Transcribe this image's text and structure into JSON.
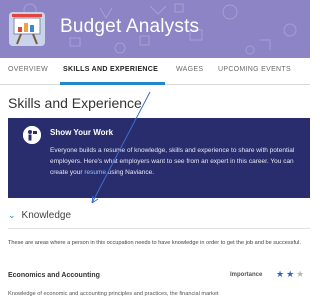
{
  "header": {
    "title": "Budget Analysts",
    "bg_color": "#8d84c6",
    "logo_icon": "chart-on-easel-icon"
  },
  "tabs": [
    {
      "label": "OVERVIEW",
      "active": false
    },
    {
      "label": "SKILLS AND EXPERIENCE",
      "active": true
    },
    {
      "label": "WAGES",
      "active": false
    },
    {
      "label": "UPCOMING EVENTS",
      "active": false
    }
  ],
  "accent_color": "#1f8ac7",
  "page": {
    "title": "Skills and Experience"
  },
  "callout": {
    "heading": "Show Your Work",
    "body_pre": "Everyone builds a resume of knowledge, skills and experience to share with potential employers. Here's what employers want to see from an expert in this career. You can create your ",
    "link_text": "resume",
    "body_post": " using Naviance.",
    "bg_color": "#2a2d6d",
    "icon": "person-presenting-icon"
  },
  "section": {
    "label": "Knowledge",
    "chevron_icon": "chevron-down-icon",
    "intro": "These are areas where a person in this occupation needs to have knowledge in order to get the job and be successful."
  },
  "skill": {
    "title": "Economics and Accounting",
    "importance_label": "Importance",
    "rating_filled": 2,
    "rating_shown": 3,
    "description": "Knowledge of economic and accounting principles and practices, the financial market"
  }
}
